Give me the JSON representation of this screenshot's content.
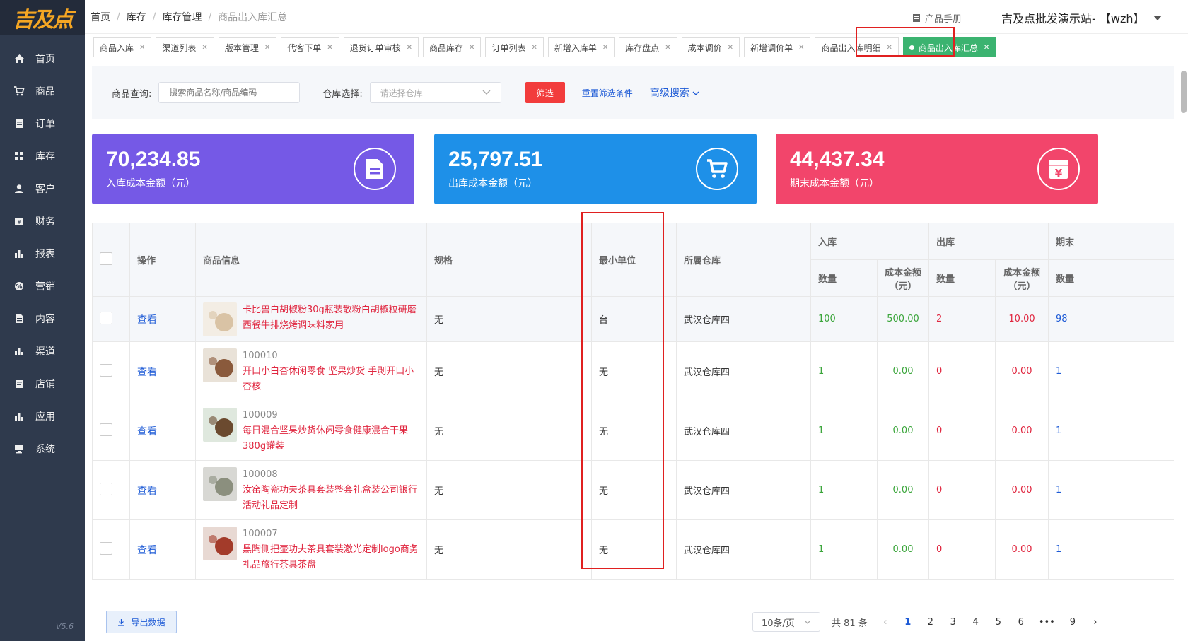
{
  "logo": "吉及点",
  "version": "V5.6",
  "sidebar": {
    "items": [
      {
        "label": "首页",
        "icon": "home-icon"
      },
      {
        "label": "商品",
        "icon": "cart-icon"
      },
      {
        "label": "订单",
        "icon": "order-icon"
      },
      {
        "label": "库存",
        "icon": "grid-icon"
      },
      {
        "label": "客户",
        "icon": "user-icon"
      },
      {
        "label": "财务",
        "icon": "finance-icon"
      },
      {
        "label": "报表",
        "icon": "bar-chart-icon"
      },
      {
        "label": "营销",
        "icon": "percent-icon"
      },
      {
        "label": "内容",
        "icon": "document-icon"
      },
      {
        "label": "渠道",
        "icon": "bar-chart-icon"
      },
      {
        "label": "店铺",
        "icon": "store-icon"
      },
      {
        "label": "应用",
        "icon": "bar-chart-icon"
      },
      {
        "label": "系统",
        "icon": "monitor-icon"
      }
    ]
  },
  "breadcrumb": [
    "首页",
    "库存",
    "库存管理",
    "商品出入库汇总"
  ],
  "header": {
    "manual": "产品手册",
    "user": "吉及点批发演示站- 【wzh】"
  },
  "tabs": [
    "商品入库",
    "渠道列表",
    "版本管理",
    "代客下单",
    "退货订单审核",
    "商品库存",
    "订单列表",
    "新增入库单",
    "库存盘点",
    "成本调价",
    "新增调价单",
    "商品出入库明细",
    "商品出入库汇总"
  ],
  "filter": {
    "product_label": "商品查询:",
    "product_placeholder": "搜索商品名称/商品编码",
    "warehouse_label": "仓库选择:",
    "warehouse_placeholder": "请选择仓库",
    "filter_btn": "筛选",
    "reset": "重置筛选条件",
    "advanced": "高级搜索"
  },
  "cards": [
    {
      "value": "70,234.85",
      "label": "入库成本金额（元）",
      "color": "#7559e6",
      "icon": "document-icon"
    },
    {
      "value": "25,797.51",
      "label": "出库成本金额（元）",
      "color": "#1e90e8",
      "icon": "cart-icon"
    },
    {
      "value": "44,437.34",
      "label": "期末成本金额（元）",
      "color": "#f2456b",
      "icon": "yen-icon"
    }
  ],
  "table": {
    "headers": {
      "op": "操作",
      "info": "商品信息",
      "spec": "规格",
      "unit": "最小单位",
      "warehouse": "所属仓库",
      "in": "入库",
      "out": "出库",
      "end": "期末",
      "qty": "数量",
      "cost": "成本金额（元）"
    },
    "view": "查看",
    "rows": [
      {
        "code": "",
        "name": "卡比兽白胡椒粉30g瓶装散粉白胡椒粒研磨西餐牛排烧烤调味料家用",
        "spec": "无",
        "unit": "台",
        "warehouse": "武汉仓库四",
        "in_qty": "100",
        "in_cost": "500.00",
        "out_qty": "2",
        "out_cost": "10.00",
        "end_qty": "98"
      },
      {
        "code": "100010",
        "name": "开口小白杏休闲零食 坚果炒货 手剥开口小杏核",
        "spec": "无",
        "unit": "无",
        "warehouse": "武汉仓库四",
        "in_qty": "1",
        "in_cost": "0.00",
        "out_qty": "0",
        "out_cost": "0.00",
        "end_qty": "1"
      },
      {
        "code": "100009",
        "name": "每日混合坚果炒货休闲零食健康混合干果380g罐装",
        "spec": "无",
        "unit": "无",
        "warehouse": "武汉仓库四",
        "in_qty": "1",
        "in_cost": "0.00",
        "out_qty": "0",
        "out_cost": "0.00",
        "end_qty": "1"
      },
      {
        "code": "100008",
        "name": "汝窑陶瓷功夫茶具套装整套礼盒装公司银行活动礼品定制",
        "spec": "无",
        "unit": "无",
        "warehouse": "武汉仓库四",
        "in_qty": "1",
        "in_cost": "0.00",
        "out_qty": "0",
        "out_cost": "0.00",
        "end_qty": "1"
      },
      {
        "code": "100007",
        "name": "黑陶侧把壶功夫茶具套装激光定制logo商务礼品旅行茶具茶盘",
        "spec": "无",
        "unit": "无",
        "warehouse": "武汉仓库四",
        "in_qty": "1",
        "in_cost": "0.00",
        "out_qty": "0",
        "out_cost": "0.00",
        "end_qty": "1"
      }
    ]
  },
  "footer": {
    "export": "导出数据",
    "page_size": "10条/页",
    "total": "共 81 条",
    "pages": [
      "1",
      "2",
      "3",
      "4",
      "5",
      "6",
      "•••",
      "9"
    ]
  }
}
